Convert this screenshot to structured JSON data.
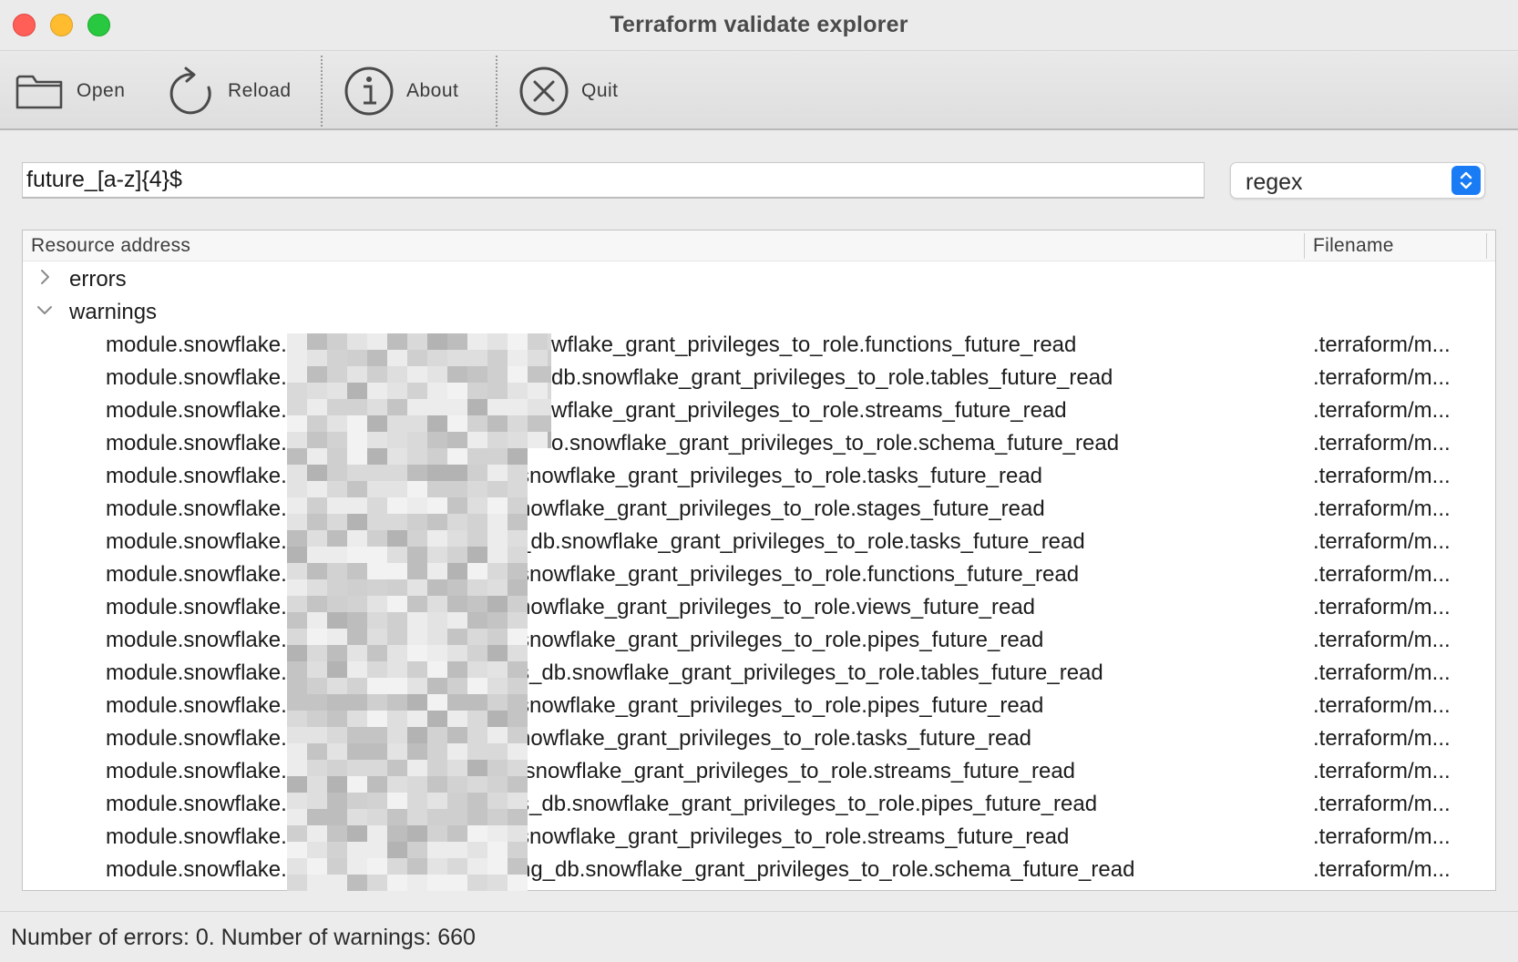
{
  "window": {
    "title": "Terraform validate explorer"
  },
  "toolbar": {
    "open_label": "Open",
    "reload_label": "Reload",
    "about_label": "About",
    "quit_label": "Quit",
    "icons": {
      "open": "folder-icon",
      "reload": "reload-icon",
      "about": "info-icon",
      "quit": "close-circle-icon"
    }
  },
  "filter": {
    "value": "future_[a-z]{4}$",
    "mode": "regex"
  },
  "tree": {
    "columns": [
      "Resource address",
      "Filename"
    ],
    "groups": [
      {
        "label": "errors",
        "expanded": false
      },
      {
        "label": "warnings",
        "expanded": true
      }
    ],
    "warnings": [
      {
        "prefix": "module.snowflake.",
        "suffix": "wflake_grant_privileges_to_role.functions_future_read",
        "file": ".terraform/m..."
      },
      {
        "prefix": "module.snowflake.",
        "suffix": "db.snowflake_grant_privileges_to_role.tables_future_read",
        "file": ".terraform/m..."
      },
      {
        "prefix": "module.snowflake.",
        "suffix": "wflake_grant_privileges_to_role.streams_future_read",
        "file": ".terraform/m..."
      },
      {
        "prefix": "module.snowflake.",
        "suffix": "o.snowflake_grant_privileges_to_role.schema_future_read",
        "file": ".terraform/m..."
      },
      {
        "prefix": "module.snowflake.",
        "suffix": "snowflake_grant_privileges_to_role.tasks_future_read",
        "file": ".terraform/m..."
      },
      {
        "prefix": "module.snowflake.",
        "suffix": "nowflake_grant_privileges_to_role.stages_future_read",
        "file": ".terraform/m..."
      },
      {
        "prefix": "module.snowflake.",
        "suffix": "_db.snowflake_grant_privileges_to_role.tasks_future_read",
        "file": ".terraform/m..."
      },
      {
        "prefix": "module.snowflake.",
        "suffix": "snowflake_grant_privileges_to_role.functions_future_read",
        "file": ".terraform/m..."
      },
      {
        "prefix": "module.snowflake.",
        "suffix": "nowflake_grant_privileges_to_role.views_future_read",
        "file": ".terraform/m..."
      },
      {
        "prefix": "module.snowflake.",
        "suffix": "snowflake_grant_privileges_to_role.pipes_future_read",
        "file": ".terraform/m..."
      },
      {
        "prefix": "module.snowflake.",
        "suffix": "s_db.snowflake_grant_privileges_to_role.tables_future_read",
        "file": ".terraform/m..."
      },
      {
        "prefix": "module.snowflake.",
        "suffix": "snowflake_grant_privileges_to_role.pipes_future_read",
        "file": ".terraform/m..."
      },
      {
        "prefix": "module.snowflake.",
        "suffix": "nowflake_grant_privileges_to_role.tasks_future_read",
        "file": ".terraform/m..."
      },
      {
        "prefix": "module.snowflake.",
        "suffix": ".snowflake_grant_privileges_to_role.streams_future_read",
        "file": ".terraform/m..."
      },
      {
        "prefix": "module.snowflake.",
        "suffix": "s_db.snowflake_grant_privileges_to_role.pipes_future_read",
        "file": ".terraform/m..."
      },
      {
        "prefix": "module.snowflake.",
        "suffix": "snowflake_grant_privileges_to_role.streams_future_read",
        "file": ".terraform/m..."
      },
      {
        "prefix": "module.snowflake.",
        "suffix": "ng_db.snowflake_grant_privileges_to_role.schema_future_read",
        "file": ".terraform/m..."
      }
    ]
  },
  "status": {
    "text": "Number of errors: 0. Number of warnings: 660"
  }
}
